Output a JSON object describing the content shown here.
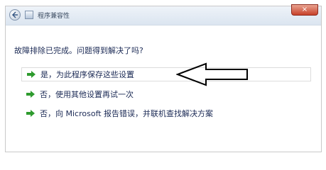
{
  "titlebar": {
    "title": "程序兼容性",
    "close_label": "×"
  },
  "main": {
    "question": "故障排除已完成。问题得到解决了吗?",
    "options": [
      {
        "label": "是，为此程序保存这些设置"
      },
      {
        "label": "否，使用其他设置再试一次"
      },
      {
        "label": "否，向 Microsoft 报告错误，并联机查找解决方案"
      }
    ]
  },
  "colors": {
    "text": "#1b2a55",
    "arrow_green": "#2e9b2e"
  }
}
